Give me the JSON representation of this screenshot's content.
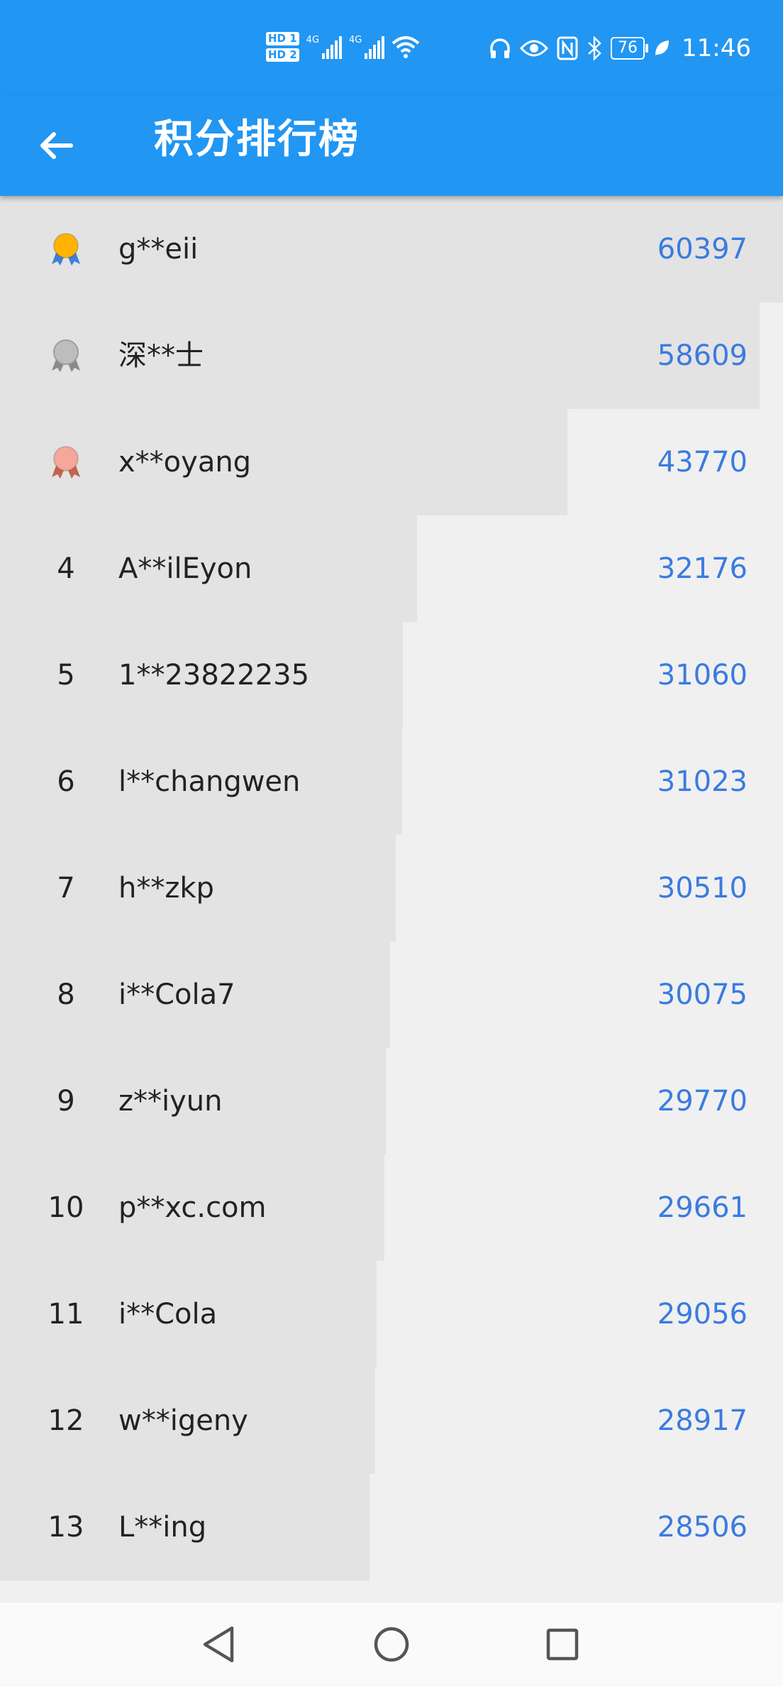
{
  "status_bar": {
    "hd1": "HD 1",
    "hd2": "HD 2",
    "net1": "4G",
    "net2": "4G",
    "battery": "76",
    "time": "11:46",
    "icons": [
      "headphones-icon",
      "eye-icon",
      "nfc-icon",
      "bluetooth-icon",
      "battery-icon",
      "leaf-icon",
      "wifi-icon",
      "signal-icon"
    ]
  },
  "app_bar": {
    "title": "积分排行榜",
    "back_icon": "arrow-left-icon"
  },
  "leaderboard": {
    "bar_color": "#e3e3e3",
    "score_color": "#3b7be0",
    "medals": {
      "gold": "#ffb300",
      "silver": "#bdbdbd",
      "bronze": "#f4a79a"
    },
    "rows": [
      {
        "rank": "1",
        "medal": "gold",
        "name": "g**eii",
        "score": "60397",
        "score_value": 60397
      },
      {
        "rank": "2",
        "medal": "silver",
        "name": "深**士",
        "score": "58609",
        "score_value": 58609
      },
      {
        "rank": "3",
        "medal": "bronze",
        "name": "x**oyang",
        "score": "43770",
        "score_value": 43770
      },
      {
        "rank": "4",
        "medal": "",
        "name": "A**ilEyon",
        "score": "32176",
        "score_value": 32176
      },
      {
        "rank": "5",
        "medal": "",
        "name": "1**23822235",
        "score": "31060",
        "score_value": 31060
      },
      {
        "rank": "6",
        "medal": "",
        "name": "l**changwen",
        "score": "31023",
        "score_value": 31023
      },
      {
        "rank": "7",
        "medal": "",
        "name": "h**zkp",
        "score": "30510",
        "score_value": 30510
      },
      {
        "rank": "8",
        "medal": "",
        "name": "i**Cola7",
        "score": "30075",
        "score_value": 30075
      },
      {
        "rank": "9",
        "medal": "",
        "name": "z**iyun",
        "score": "29770",
        "score_value": 29770
      },
      {
        "rank": "10",
        "medal": "",
        "name": "p**xc.com",
        "score": "29661",
        "score_value": 29661
      },
      {
        "rank": "11",
        "medal": "",
        "name": "i**Cola",
        "score": "29056",
        "score_value": 29056
      },
      {
        "rank": "12",
        "medal": "",
        "name": "w**igeny",
        "score": "28917",
        "score_value": 28917
      },
      {
        "rank": "13",
        "medal": "",
        "name": "L**ing",
        "score": "28506",
        "score_value": 28506
      }
    ]
  },
  "nav_bar": {
    "buttons": [
      "back-triangle-icon",
      "home-circle-icon",
      "recents-square-icon"
    ]
  }
}
